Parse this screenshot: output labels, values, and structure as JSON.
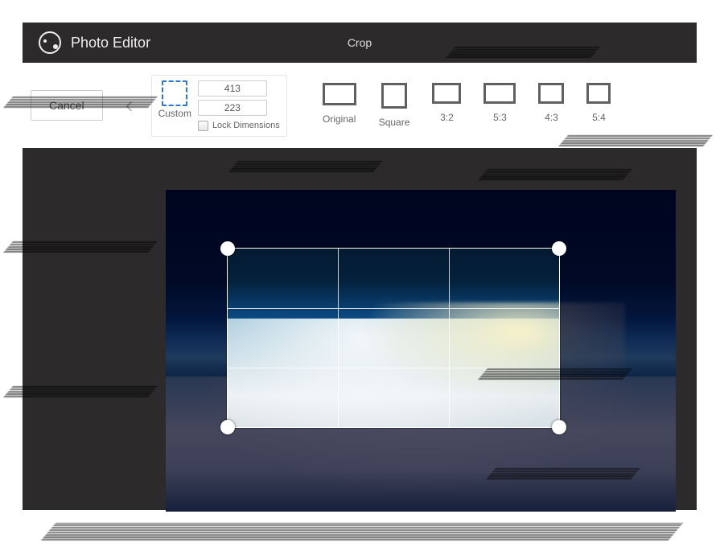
{
  "header": {
    "app_title": "Photo Editor",
    "mode_title": "Crop"
  },
  "toolbar": {
    "cancel_label": "Cancel",
    "custom": {
      "label": "Custom",
      "width_value": "413",
      "height_value": "223",
      "lock_label": "Lock Dimensions",
      "lock_checked": false
    },
    "presets": [
      {
        "label": "Original"
      },
      {
        "label": "Square"
      },
      {
        "label": "3:2"
      },
      {
        "label": "5:3"
      },
      {
        "label": "4:3"
      },
      {
        "label": "5:4"
      }
    ]
  }
}
